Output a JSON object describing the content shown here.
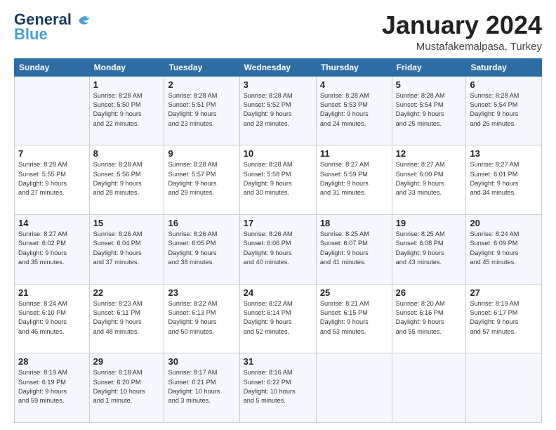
{
  "header": {
    "logo_line1": "General",
    "logo_line2": "Blue",
    "month_title": "January 2024",
    "location": "Mustafakemalpasa, Turkey"
  },
  "weekdays": [
    "Sunday",
    "Monday",
    "Tuesday",
    "Wednesday",
    "Thursday",
    "Friday",
    "Saturday"
  ],
  "weeks": [
    [
      {
        "day": "",
        "info": ""
      },
      {
        "day": "1",
        "info": "Sunrise: 8:28 AM\nSunset: 5:50 PM\nDaylight: 9 hours\nand 22 minutes."
      },
      {
        "day": "2",
        "info": "Sunrise: 8:28 AM\nSunset: 5:51 PM\nDaylight: 9 hours\nand 23 minutes."
      },
      {
        "day": "3",
        "info": "Sunrise: 8:28 AM\nSunset: 5:52 PM\nDaylight: 9 hours\nand 23 minutes."
      },
      {
        "day": "4",
        "info": "Sunrise: 8:28 AM\nSunset: 5:53 PM\nDaylight: 9 hours\nand 24 minutes."
      },
      {
        "day": "5",
        "info": "Sunrise: 8:28 AM\nSunset: 5:54 PM\nDaylight: 9 hours\nand 25 minutes."
      },
      {
        "day": "6",
        "info": "Sunrise: 8:28 AM\nSunset: 5:54 PM\nDaylight: 9 hours\nand 26 minutes."
      }
    ],
    [
      {
        "day": "7",
        "info": "Sunrise: 8:28 AM\nSunset: 5:55 PM\nDaylight: 9 hours\nand 27 minutes."
      },
      {
        "day": "8",
        "info": "Sunrise: 8:28 AM\nSunset: 5:56 PM\nDaylight: 9 hours\nand 28 minutes."
      },
      {
        "day": "9",
        "info": "Sunrise: 8:28 AM\nSunset: 5:57 PM\nDaylight: 9 hours\nand 29 minutes."
      },
      {
        "day": "10",
        "info": "Sunrise: 8:28 AM\nSunset: 5:58 PM\nDaylight: 9 hours\nand 30 minutes."
      },
      {
        "day": "11",
        "info": "Sunrise: 8:27 AM\nSunset: 5:59 PM\nDaylight: 9 hours\nand 31 minutes."
      },
      {
        "day": "12",
        "info": "Sunrise: 8:27 AM\nSunset: 6:00 PM\nDaylight: 9 hours\nand 33 minutes."
      },
      {
        "day": "13",
        "info": "Sunrise: 8:27 AM\nSunset: 6:01 PM\nDaylight: 9 hours\nand 34 minutes."
      }
    ],
    [
      {
        "day": "14",
        "info": "Sunrise: 8:27 AM\nSunset: 6:02 PM\nDaylight: 9 hours\nand 35 minutes."
      },
      {
        "day": "15",
        "info": "Sunrise: 8:26 AM\nSunset: 6:04 PM\nDaylight: 9 hours\nand 37 minutes."
      },
      {
        "day": "16",
        "info": "Sunrise: 8:26 AM\nSunset: 6:05 PM\nDaylight: 9 hours\nand 38 minutes."
      },
      {
        "day": "17",
        "info": "Sunrise: 8:26 AM\nSunset: 6:06 PM\nDaylight: 9 hours\nand 40 minutes."
      },
      {
        "day": "18",
        "info": "Sunrise: 8:25 AM\nSunset: 6:07 PM\nDaylight: 9 hours\nand 41 minutes."
      },
      {
        "day": "19",
        "info": "Sunrise: 8:25 AM\nSunset: 6:08 PM\nDaylight: 9 hours\nand 43 minutes."
      },
      {
        "day": "20",
        "info": "Sunrise: 8:24 AM\nSunset: 6:09 PM\nDaylight: 9 hours\nand 45 minutes."
      }
    ],
    [
      {
        "day": "21",
        "info": "Sunrise: 8:24 AM\nSunset: 6:10 PM\nDaylight: 9 hours\nand 46 minutes."
      },
      {
        "day": "22",
        "info": "Sunrise: 8:23 AM\nSunset: 6:11 PM\nDaylight: 9 hours\nand 48 minutes."
      },
      {
        "day": "23",
        "info": "Sunrise: 8:22 AM\nSunset: 6:13 PM\nDaylight: 9 hours\nand 50 minutes."
      },
      {
        "day": "24",
        "info": "Sunrise: 8:22 AM\nSunset: 6:14 PM\nDaylight: 9 hours\nand 52 minutes."
      },
      {
        "day": "25",
        "info": "Sunrise: 8:21 AM\nSunset: 6:15 PM\nDaylight: 9 hours\nand 53 minutes."
      },
      {
        "day": "26",
        "info": "Sunrise: 8:20 AM\nSunset: 6:16 PM\nDaylight: 9 hours\nand 55 minutes."
      },
      {
        "day": "27",
        "info": "Sunrise: 8:19 AM\nSunset: 6:17 PM\nDaylight: 9 hours\nand 57 minutes."
      }
    ],
    [
      {
        "day": "28",
        "info": "Sunrise: 8:19 AM\nSunset: 6:19 PM\nDaylight: 9 hours\nand 59 minutes."
      },
      {
        "day": "29",
        "info": "Sunrise: 8:18 AM\nSunset: 6:20 PM\nDaylight: 10 hours\nand 1 minute."
      },
      {
        "day": "30",
        "info": "Sunrise: 8:17 AM\nSunset: 6:21 PM\nDaylight: 10 hours\nand 3 minutes."
      },
      {
        "day": "31",
        "info": "Sunrise: 8:16 AM\nSunset: 6:22 PM\nDaylight: 10 hours\nand 5 minutes."
      },
      {
        "day": "",
        "info": ""
      },
      {
        "day": "",
        "info": ""
      },
      {
        "day": "",
        "info": ""
      }
    ]
  ]
}
